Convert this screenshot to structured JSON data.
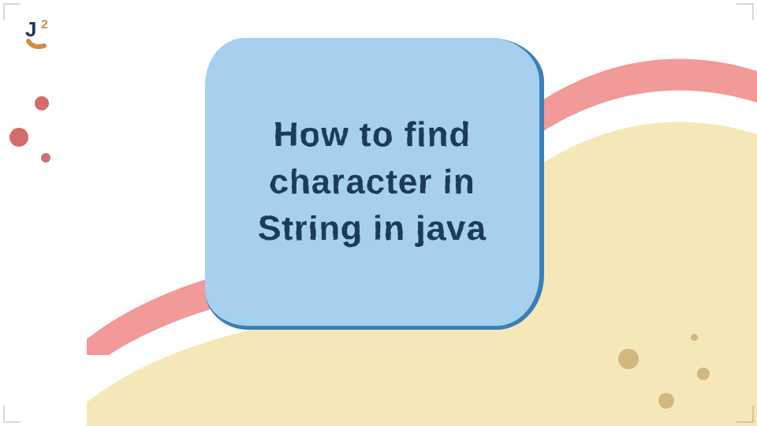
{
  "logo": {
    "name": "J2"
  },
  "hero": {
    "title": "How to find character in String in java"
  },
  "colors": {
    "blob_bg": "#a7d0ee",
    "title_text": "#1a3a5c",
    "yellow_wave": "#f5e8b8",
    "pink_wave": "#f29999",
    "dot_red": "#d66b6b",
    "dot_tan": "#d4b680"
  }
}
